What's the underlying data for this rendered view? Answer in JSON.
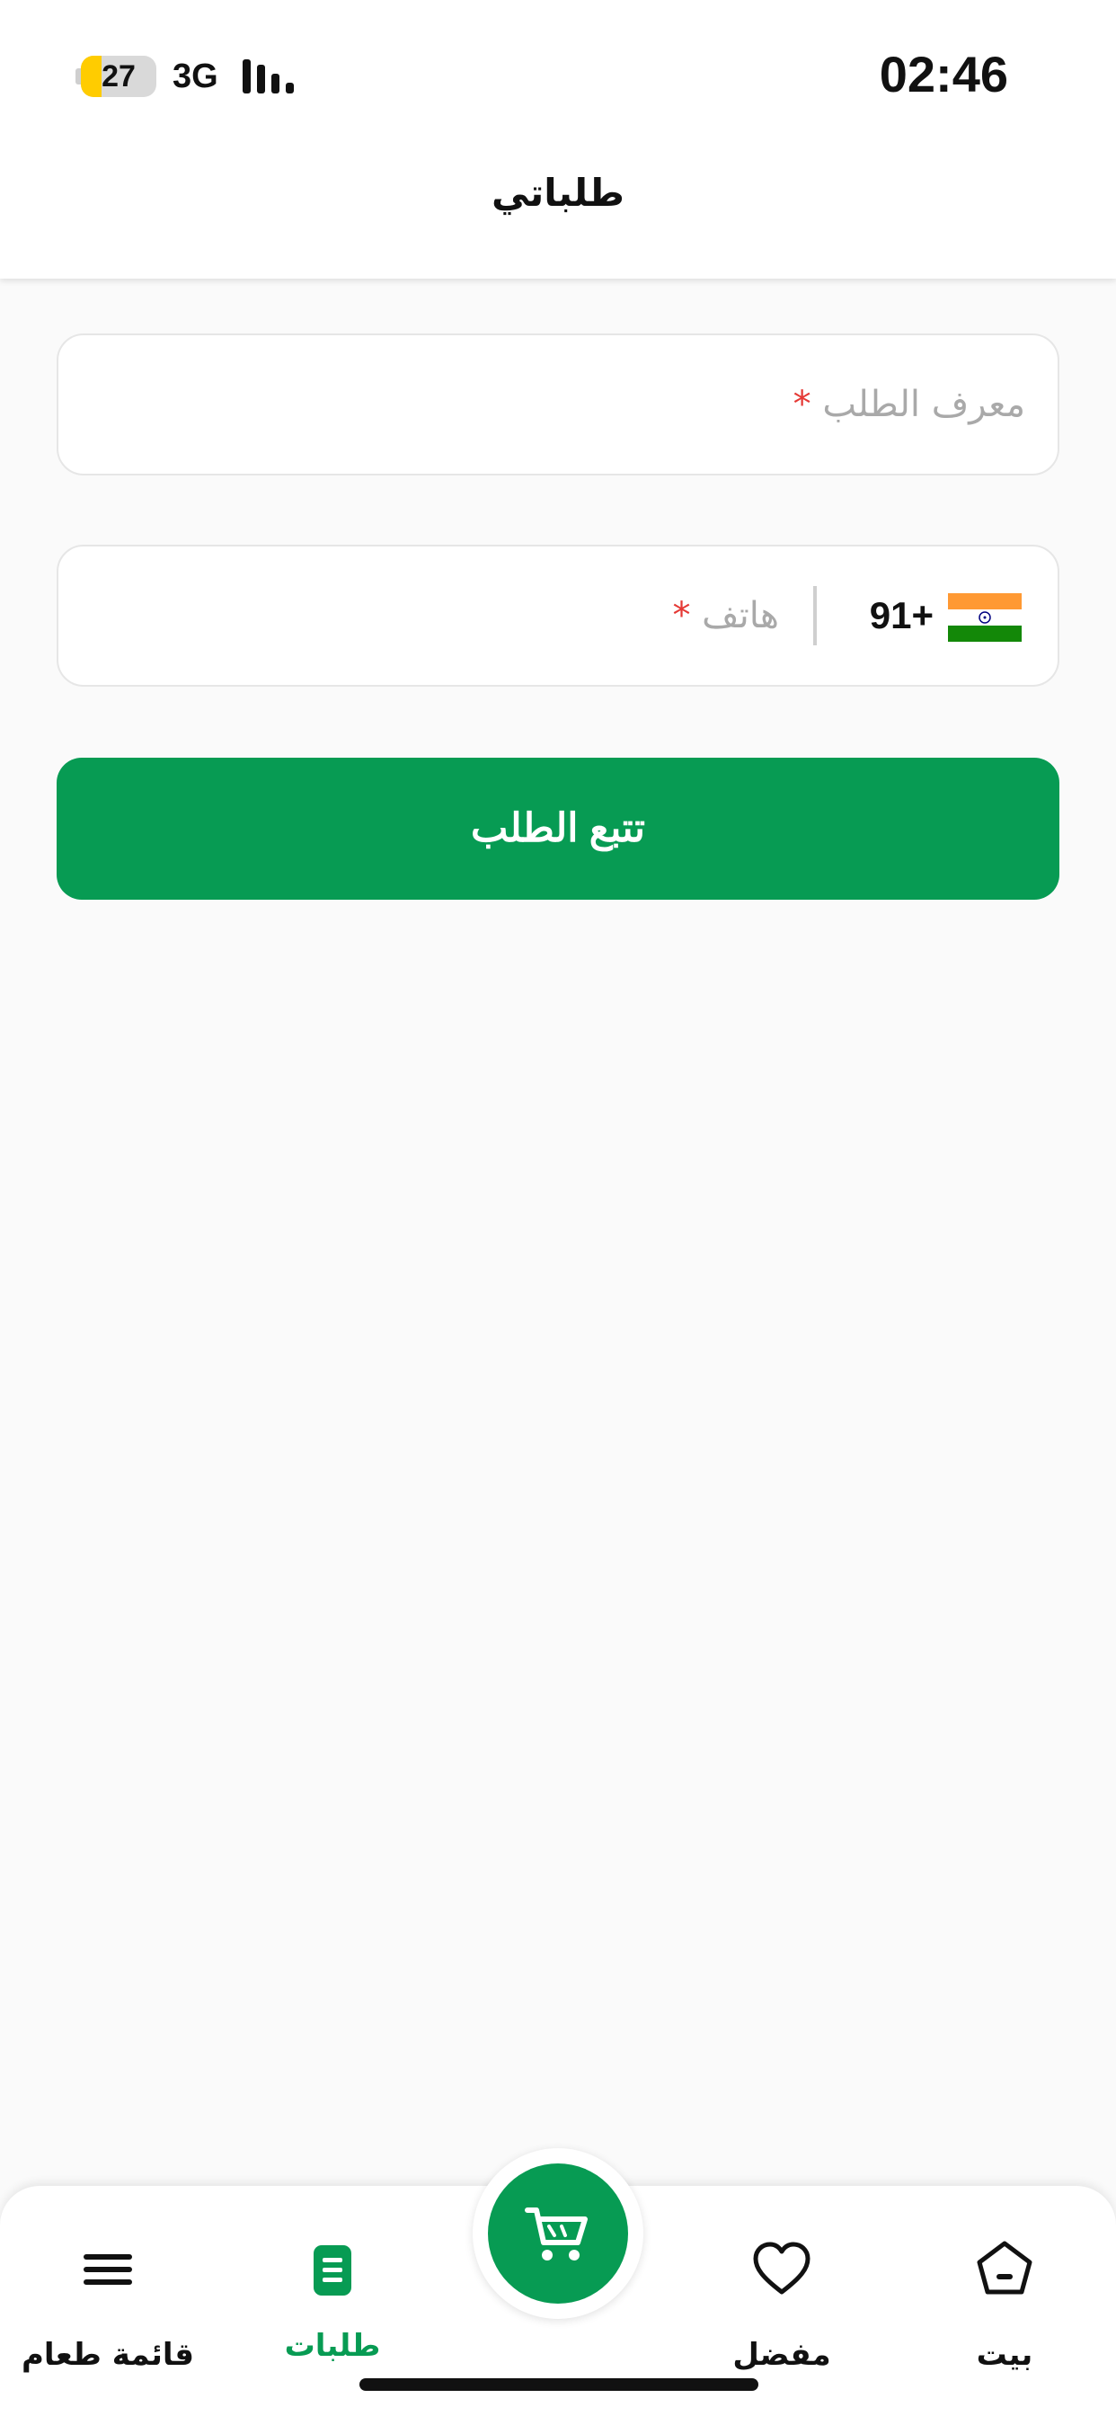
{
  "status_bar": {
    "battery_level": "27",
    "battery_fill_percent": 27,
    "network": "3G",
    "time": "02:46"
  },
  "header": {
    "title": "طلباتي"
  },
  "form": {
    "order_id_placeholder": "معرف الطلب",
    "phone_placeholder": "هاتف",
    "required_mark": "*",
    "country_code": "91+",
    "country_flag": "india-flag-icon",
    "track_button_label": "تتبع الطلب"
  },
  "colors": {
    "primary": "#079b53",
    "required": "#e53935",
    "placeholder": "#a9a9a9",
    "background": "#fafafa"
  },
  "bottom_nav": {
    "items": [
      {
        "label": "قائمة طعام",
        "icon": "menu-icon",
        "active": false
      },
      {
        "label": "طلبات",
        "icon": "orders-icon",
        "active": true
      },
      {
        "label": "مفضل",
        "icon": "heart-icon",
        "active": false
      },
      {
        "label": "بيت",
        "icon": "home-icon",
        "active": false
      }
    ],
    "center_button": {
      "icon": "cart-icon"
    }
  }
}
